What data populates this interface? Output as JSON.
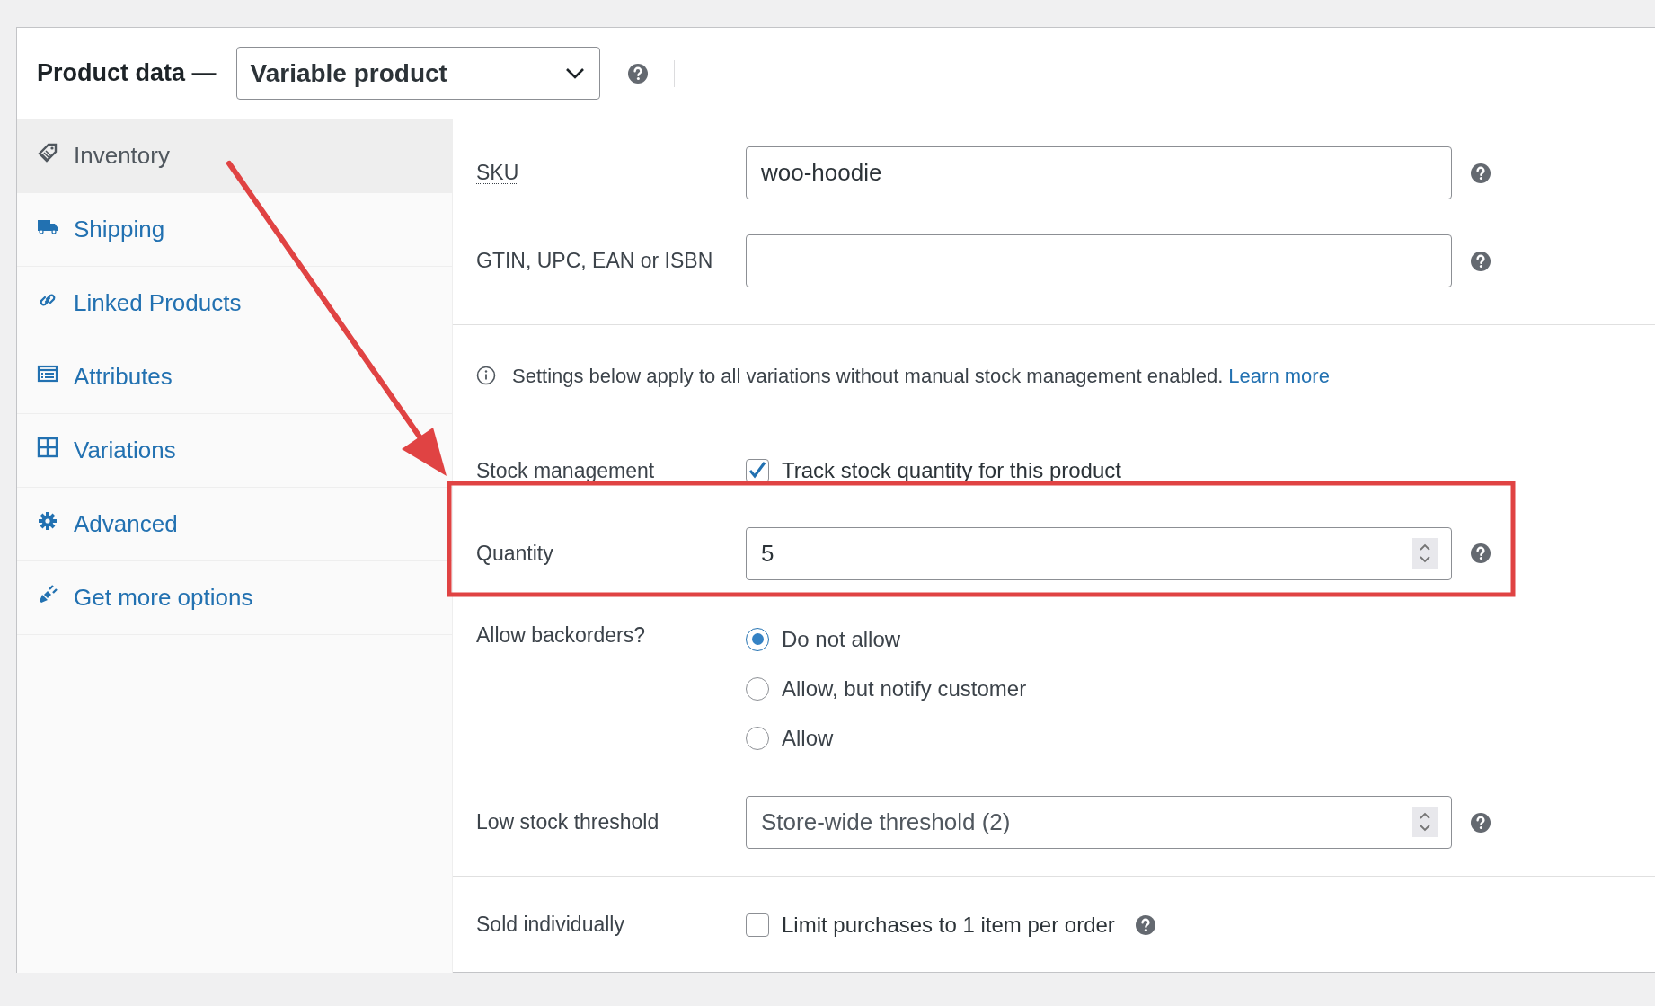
{
  "header": {
    "title": "Product data —",
    "product_type": "Variable product"
  },
  "tabs": [
    {
      "label": "Inventory",
      "kind": "tag",
      "selected": true
    },
    {
      "label": "Shipping",
      "kind": "truck",
      "selected": false
    },
    {
      "label": "Linked Products",
      "kind": "link",
      "selected": false
    },
    {
      "label": "Attributes",
      "kind": "list",
      "selected": false
    },
    {
      "label": "Variations",
      "kind": "grid",
      "selected": false
    },
    {
      "label": "Advanced",
      "kind": "gear",
      "selected": false
    },
    {
      "label": "Get more options",
      "kind": "plugin",
      "selected": false
    }
  ],
  "sku": {
    "label": "SKU",
    "value": "woo-hoodie"
  },
  "gtin": {
    "label": "GTIN, UPC, EAN or ISBN"
  },
  "notice": {
    "text": "Settings below apply to all variations without manual stock management enabled.",
    "link": "Learn more"
  },
  "stock_management": {
    "label": "Stock management",
    "option": "Track stock quantity for this product",
    "checked": true
  },
  "quantity": {
    "label": "Quantity",
    "value": "5"
  },
  "backorders": {
    "label": "Allow backorders?",
    "options": [
      {
        "label": "Do not allow",
        "selected": true
      },
      {
        "label": "Allow, but notify customer",
        "selected": false
      },
      {
        "label": "Allow",
        "selected": false
      }
    ]
  },
  "low_stock": {
    "label": "Low stock threshold",
    "placeholder": "Store-wide threshold (2)"
  },
  "sold_individually": {
    "label": "Sold individually",
    "option": "Limit purchases to 1 item per order",
    "checked": false
  }
}
